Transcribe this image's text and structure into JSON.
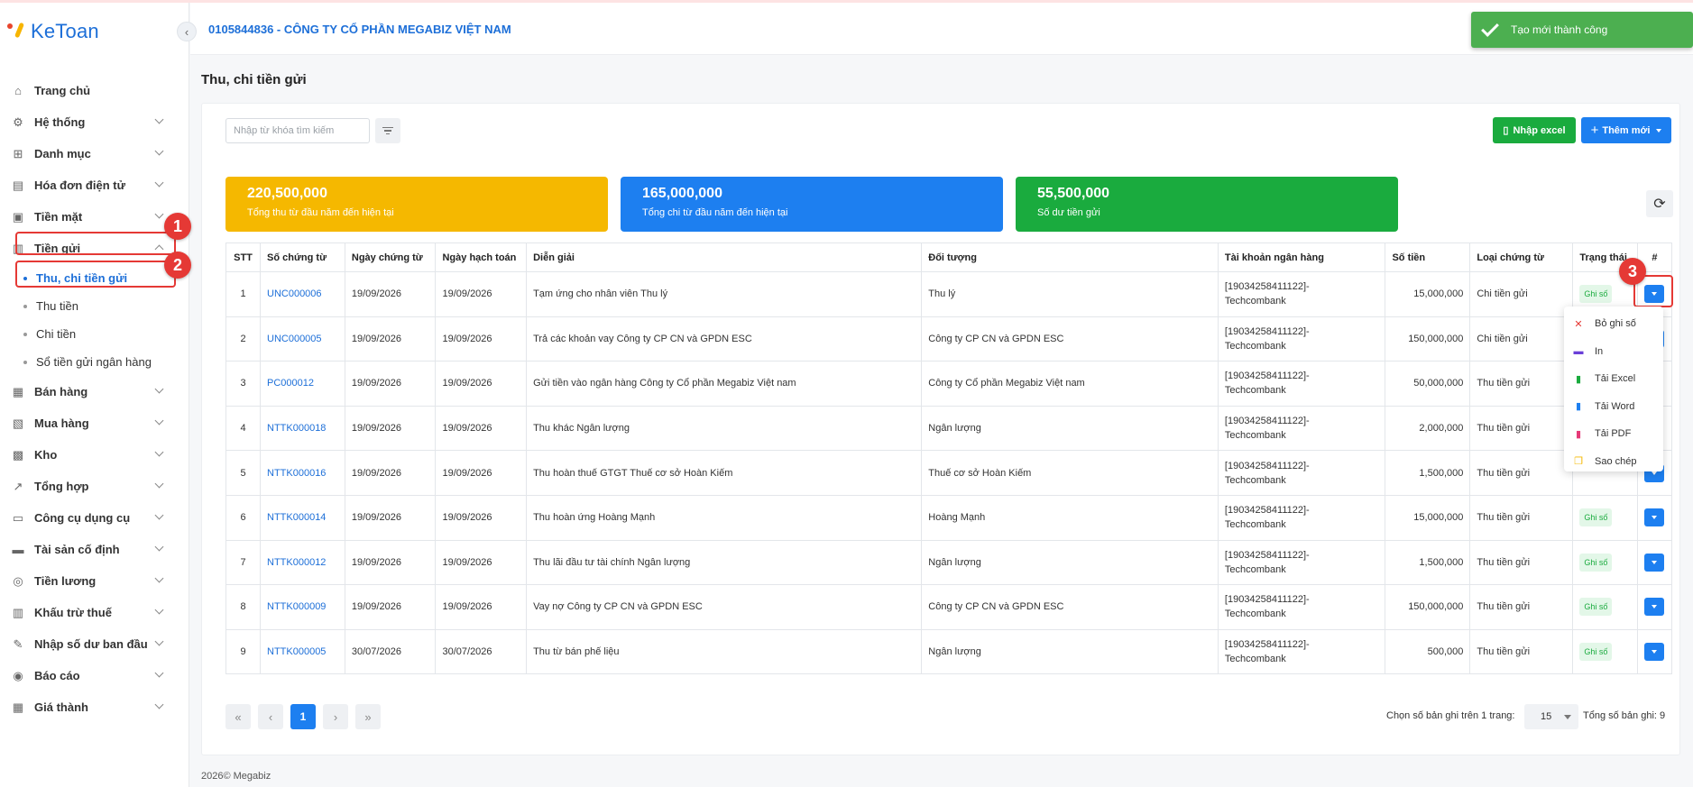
{
  "app": {
    "logo": "KeToan"
  },
  "header": {
    "company": "0105844836 - CÔNG TY CỔ PHẦN MEGABIZ VIỆT NAM"
  },
  "toast": {
    "message": "Tạo mới thành công"
  },
  "sidebar": {
    "items": [
      {
        "label": "Trang chủ",
        "icon": "home-icon"
      },
      {
        "label": "Hệ thống",
        "icon": "gear-icon"
      },
      {
        "label": "Danh mục",
        "icon": "grid-icon"
      },
      {
        "label": "Hóa đơn điện tử",
        "icon": "invoice-icon"
      },
      {
        "label": "Tiền mặt",
        "icon": "cash-icon"
      },
      {
        "label": "Tiền gửi",
        "icon": "bank-icon"
      },
      {
        "label": "Bán hàng",
        "icon": "sale-icon"
      },
      {
        "label": "Mua hàng",
        "icon": "purchase-icon"
      },
      {
        "label": "Kho",
        "icon": "warehouse-icon"
      },
      {
        "label": "Tổng hợp",
        "icon": "chart-icon"
      },
      {
        "label": "Công cụ dụng cụ",
        "icon": "tools-icon"
      },
      {
        "label": "Tài sản cố định",
        "icon": "car-icon"
      },
      {
        "label": "Tiền lương",
        "icon": "money-icon"
      },
      {
        "label": "Khấu trừ thuế",
        "icon": "tax-icon"
      },
      {
        "label": "Nhập số dư ban đầu",
        "icon": "edit-icon"
      },
      {
        "label": "Báo cáo",
        "icon": "report-icon"
      },
      {
        "label": "Giá thành",
        "icon": "calculator-icon"
      }
    ],
    "sub_items": [
      {
        "label": "Thu, chi tiền gửi"
      },
      {
        "label": "Thu tiền"
      },
      {
        "label": "Chi tiền"
      },
      {
        "label": "Sổ tiền gửi ngân hàng"
      }
    ]
  },
  "annotations": [
    "1",
    "2",
    "3"
  ],
  "page": {
    "title": "Thu, chi tiền gửi"
  },
  "toolbar": {
    "search_placeholder": "Nhập từ khóa tìm kiếm",
    "import_excel": "Nhập excel",
    "add_new": "Thêm mới"
  },
  "stats": [
    {
      "value": "220,500,000",
      "label": "Tổng thu từ đầu năm đến hiện tại",
      "color": "#f5b800"
    },
    {
      "value": "165,000,000",
      "label": "Tổng chi từ đầu năm đến hiện tại",
      "color": "#1d7ff0"
    },
    {
      "value": "55,500,000",
      "label": "Số dư tiền gửi",
      "color": "#1aab3e"
    }
  ],
  "table": {
    "columns": [
      "STT",
      "Số chứng từ",
      "Ngày chứng từ",
      "Ngày hạch toán",
      "Diễn giải",
      "Đối tượng",
      "Tài khoản ngân hàng",
      "Số tiền",
      "Loại chứng từ",
      "Trạng thái",
      "#"
    ],
    "rows": [
      {
        "stt": "1",
        "so": "UNC000006",
        "ngay_ct": "19/09/2026",
        "ngay_ht": "19/09/2026",
        "dien_giai": "Tạm ứng cho nhân viên Thu lý",
        "doi_tuong": "Thu lý",
        "tk1": "[19034258411122]-",
        "tk2": "Techcombank",
        "so_tien": "15,000,000",
        "loai": "Chi tiền gửi",
        "trang_thai": "Ghi số"
      },
      {
        "stt": "2",
        "so": "UNC000005",
        "ngay_ct": "19/09/2026",
        "ngay_ht": "19/09/2026",
        "dien_giai": "Trả các khoản vay Công ty CP CN và GPDN ESC",
        "doi_tuong": "Công ty CP CN và GPDN ESC",
        "tk1": "[19034258411122]-",
        "tk2": "Techcombank",
        "so_tien": "150,000,000",
        "loai": "Chi tiền gửi",
        "trang_thai": ""
      },
      {
        "stt": "3",
        "so": "PC000012",
        "ngay_ct": "19/09/2026",
        "ngay_ht": "19/09/2026",
        "dien_giai": "Gửi tiền vào ngân hàng Công ty Cổ phần Megabiz Việt nam",
        "doi_tuong": "Công ty Cổ phần Megabiz Việt nam",
        "tk1": "[19034258411122]-",
        "tk2": "Techcombank",
        "so_tien": "50,000,000",
        "loai": "Thu tiền gửi",
        "trang_thai": ""
      },
      {
        "stt": "4",
        "so": "NTTK000018",
        "ngay_ct": "19/09/2026",
        "ngay_ht": "19/09/2026",
        "dien_giai": "Thu khác Ngân lượng",
        "doi_tuong": "Ngân lượng",
        "tk1": "[19034258411122]-",
        "tk2": "Techcombank",
        "so_tien": "2,000,000",
        "loai": "Thu tiền gửi",
        "trang_thai": ""
      },
      {
        "stt": "5",
        "so": "NTTK000016",
        "ngay_ct": "19/09/2026",
        "ngay_ht": "19/09/2026",
        "dien_giai": "Thu hoàn thuế GTGT Thuế cơ sở Hoàn Kiếm",
        "doi_tuong": "Thuế cơ sở Hoàn Kiếm",
        "tk1": "[19034258411122]-",
        "tk2": "Techcombank",
        "so_tien": "1,500,000",
        "loai": "Thu tiền gửi",
        "trang_thai": ""
      },
      {
        "stt": "6",
        "so": "NTTK000014",
        "ngay_ct": "19/09/2026",
        "ngay_ht": "19/09/2026",
        "dien_giai": "Thu hoàn ứng Hoàng Mạnh",
        "doi_tuong": "Hoàng Mạnh",
        "tk1": "[19034258411122]-",
        "tk2": "Techcombank",
        "so_tien": "15,000,000",
        "loai": "Thu tiền gửi",
        "trang_thai": "Ghi số"
      },
      {
        "stt": "7",
        "so": "NTTK000012",
        "ngay_ct": "19/09/2026",
        "ngay_ht": "19/09/2026",
        "dien_giai": "Thu lãi đầu tư tài chính Ngân lượng",
        "doi_tuong": "Ngân lượng",
        "tk1": "[19034258411122]-",
        "tk2": "Techcombank",
        "so_tien": "1,500,000",
        "loai": "Thu tiền gửi",
        "trang_thai": "Ghi số"
      },
      {
        "stt": "8",
        "so": "NTTK000009",
        "ngay_ct": "19/09/2026",
        "ngay_ht": "19/09/2026",
        "dien_giai": "Vay nợ Công ty CP CN và GPDN ESC",
        "doi_tuong": "Công ty CP CN và GPDN ESC",
        "tk1": "[19034258411122]-",
        "tk2": "Techcombank",
        "so_tien": "150,000,000",
        "loai": "Thu tiền gửi",
        "trang_thai": "Ghi số"
      },
      {
        "stt": "9",
        "so": "NTTK000005",
        "ngay_ct": "30/07/2026",
        "ngay_ht": "30/07/2026",
        "dien_giai": "Thu từ bán phế liệu",
        "doi_tuong": "Ngân lượng",
        "tk1": "[19034258411122]-",
        "tk2": "Techcombank",
        "so_tien": "500,000",
        "loai": "Thu tiền gửi",
        "trang_thai": "Ghi số"
      }
    ]
  },
  "dropdown": {
    "items": [
      {
        "label": "Bỏ ghi số",
        "icon": "close-icon",
        "color": "#e53935",
        "glyph": "✕"
      },
      {
        "label": "In",
        "icon": "printer-icon",
        "color": "#6a3fd8",
        "glyph": "▬"
      },
      {
        "label": "Tải Excel",
        "icon": "excel-file-icon",
        "color": "#1aab3e",
        "glyph": "▮"
      },
      {
        "label": "Tải Word",
        "icon": "word-file-icon",
        "color": "#1d7ff0",
        "glyph": "▮"
      },
      {
        "label": "Tải PDF",
        "icon": "pdf-file-icon",
        "color": "#e53977",
        "glyph": "▮"
      },
      {
        "label": "Sao chép",
        "icon": "copy-icon",
        "color": "#f5b800",
        "glyph": "❐"
      }
    ]
  },
  "pagination": {
    "current": "1",
    "per_page_label": "Chọn số bản ghi trên 1 trang:",
    "per_page": "15",
    "total": "Tổng số bản ghi: 9"
  },
  "footer": {
    "text": "2026© Megabiz"
  }
}
